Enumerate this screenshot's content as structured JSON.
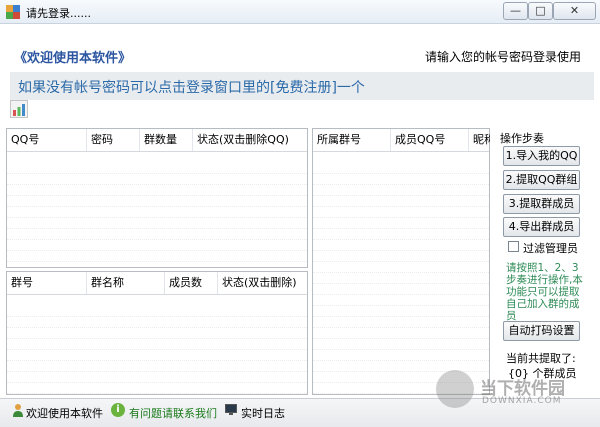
{
  "window": {
    "title": "请先登录......",
    "min_glyph": "—",
    "max_glyph": "□",
    "close_glyph": "✕"
  },
  "header": {
    "welcome": "《欢迎使用本软件》",
    "login_prompt": "请输入您的帐号密码登录使用",
    "register_hint": "如果没有帐号密码可以点击登录窗口里的[免费注册]一个"
  },
  "qq_table": {
    "columns": [
      "QQ号",
      "密码",
      "群数量",
      "状态(双击删除QQ)"
    ]
  },
  "group_table": {
    "columns": [
      "群号",
      "群名称",
      "成员数",
      "状态(双击删除)"
    ]
  },
  "member_table": {
    "columns": [
      "所属群号",
      "成员QQ号",
      "昵称"
    ]
  },
  "steps": {
    "title": "操作步奏",
    "buttons": [
      "1.导入我的QQ",
      "2.提取QQ群组",
      "3.提取群成员",
      "4.导出群成员"
    ],
    "filter_admin_label": "过滤管理员",
    "filter_admin_checked": false,
    "note": "请按照1、2、3步奏进行操作,本功能只可以提取自己加入群的成员",
    "auto_captcha": "自动打码设置",
    "count_label": "当前共提取了:",
    "count_value": "{0} 个群成员"
  },
  "statusbar": {
    "welcome": "欢迎使用本软件",
    "contact": "有问题请联系我们",
    "log": "实时日志"
  },
  "watermark": {
    "text": "当下软件园",
    "url": "DOWNXIA.COM"
  },
  "colors": {
    "accent": "#2b55a0",
    "link_green": "#1a7a1a",
    "note_green": "#2e8b57"
  }
}
